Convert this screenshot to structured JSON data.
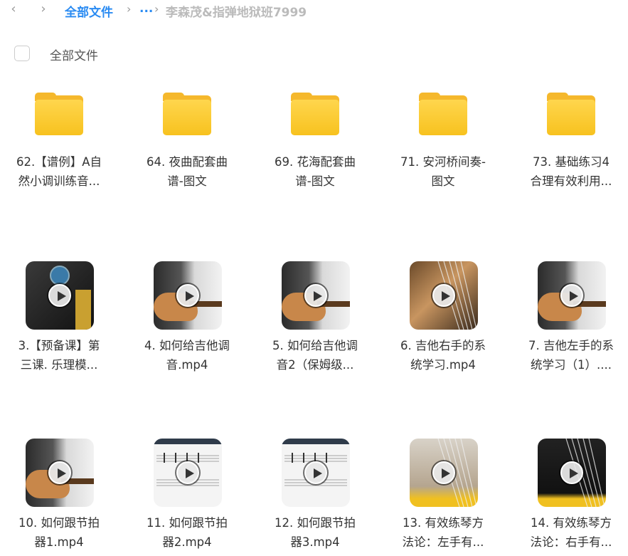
{
  "breadcrumb": {
    "back_icon": "chevron-left-icon",
    "forward_icon": "chevron-right-icon",
    "root": "全部文件",
    "ellipsis": "...",
    "current": "李森茂&指弹地狱班7999"
  },
  "select_all_label": "全部文件",
  "items": [
    {
      "type": "folder",
      "label1": "62.【谱例】A自",
      "label2": "然小调训练音..."
    },
    {
      "type": "folder",
      "label1": "64. 夜曲配套曲",
      "label2": "谱-图文"
    },
    {
      "type": "folder",
      "label1": "69. 花海配套曲",
      "label2": "谱-图文"
    },
    {
      "type": "folder",
      "label1": "71. 安河桥间奏-",
      "label2": "图文"
    },
    {
      "type": "folder",
      "label1": "73. 基础练习4",
      "label2": "合理有效利用..."
    },
    {
      "type": "video",
      "label1": "3.【预备课】第",
      "label2": "三课. 乐理模...",
      "theme": "dark-dial"
    },
    {
      "type": "video",
      "label1": "4. 如何给吉他调",
      "label2": "音.mp4",
      "theme": "player-light"
    },
    {
      "type": "video",
      "label1": "5. 如何给吉他调",
      "label2": "音2（保姆级...",
      "theme": "player-light"
    },
    {
      "type": "video",
      "label1": "6. 吉他右手的系",
      "label2": "统学习.mp4",
      "theme": "closeup-warm"
    },
    {
      "type": "video",
      "label1": "7. 吉他左手的系",
      "label2": "统学习（1）....",
      "theme": "player-light"
    },
    {
      "type": "video",
      "label1": "10. 如何跟节拍",
      "label2": "器1.mp4",
      "theme": "player-light"
    },
    {
      "type": "video",
      "label1": "11. 如何跟节拍",
      "label2": "器2.mp4",
      "theme": "score"
    },
    {
      "type": "video",
      "label1": "12. 如何跟节拍",
      "label2": "器3.mp4",
      "theme": "score"
    },
    {
      "type": "video",
      "label1": "13. 有效练琴方",
      "label2": "法论：左手有...",
      "theme": "neck-yellow"
    },
    {
      "type": "video",
      "label1": "14. 有效练琴方",
      "label2": "法论：右手有...",
      "theme": "dark-yellow"
    }
  ]
}
